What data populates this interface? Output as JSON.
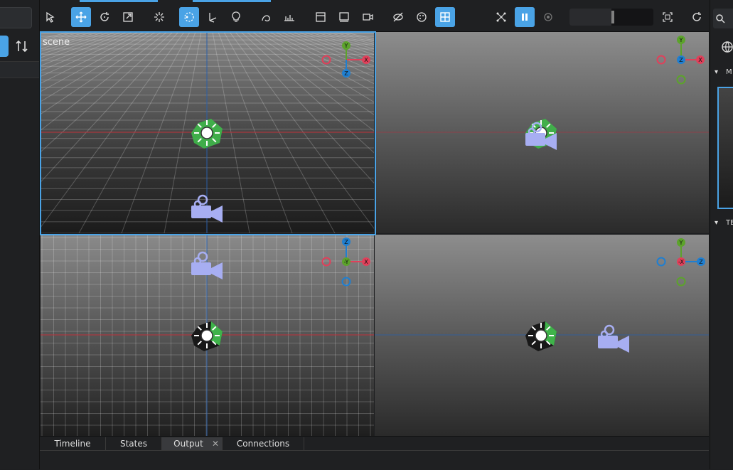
{
  "viewport_labels": {
    "top_left": "scene"
  },
  "axis_labels": {
    "x": "X",
    "y": "Y",
    "z": "Z",
    "neg_x": "-X",
    "neg_y": "-Y"
  },
  "toolbar": {
    "items": [
      {
        "name": "select-arrow-icon",
        "active": false
      },
      {
        "name": "move-icon",
        "active": true
      },
      {
        "name": "rotate-icon",
        "active": false
      },
      {
        "name": "scale-icon",
        "active": false
      },
      {
        "name": "snap-points-icon",
        "active": false
      },
      {
        "name": "pivot-select-icon",
        "active": true
      },
      {
        "name": "transform-axes-icon",
        "active": false
      },
      {
        "name": "light-bulb-icon",
        "active": false
      },
      {
        "name": "curve-tool-icon",
        "active": false
      },
      {
        "name": "measure-tool-icon",
        "active": false
      },
      {
        "name": "frame-icon",
        "active": false
      },
      {
        "name": "image-frame-icon",
        "active": false
      },
      {
        "name": "camera-frame-icon",
        "active": false
      },
      {
        "name": "visibility-off-icon",
        "active": false
      },
      {
        "name": "palette-icon",
        "active": false
      },
      {
        "name": "quad-view-icon",
        "active": true
      },
      {
        "name": "node-graph-icon",
        "active": false
      },
      {
        "name": "pause-icon",
        "active": true
      },
      {
        "name": "capture-icon",
        "active": false
      },
      {
        "name": "fullscreen-icon",
        "active": false
      },
      {
        "name": "refresh-icon",
        "active": false
      }
    ],
    "slider_value": 0.5
  },
  "right_panel": {
    "section_1": "M",
    "section_2": "TE"
  },
  "bottom_tabs": [
    {
      "label": "Timeline"
    },
    {
      "label": "States"
    },
    {
      "label": "Output",
      "selected": true,
      "closable": true
    },
    {
      "label": "Connections"
    }
  ],
  "colors": {
    "accent": "#4aa3e6",
    "axis_x": "#e0405a",
    "axis_y": "#5ca32b",
    "axis_z": "#1f7fd1",
    "gizmo_green": "#3fb34a",
    "camera": "#a7aef2"
  }
}
